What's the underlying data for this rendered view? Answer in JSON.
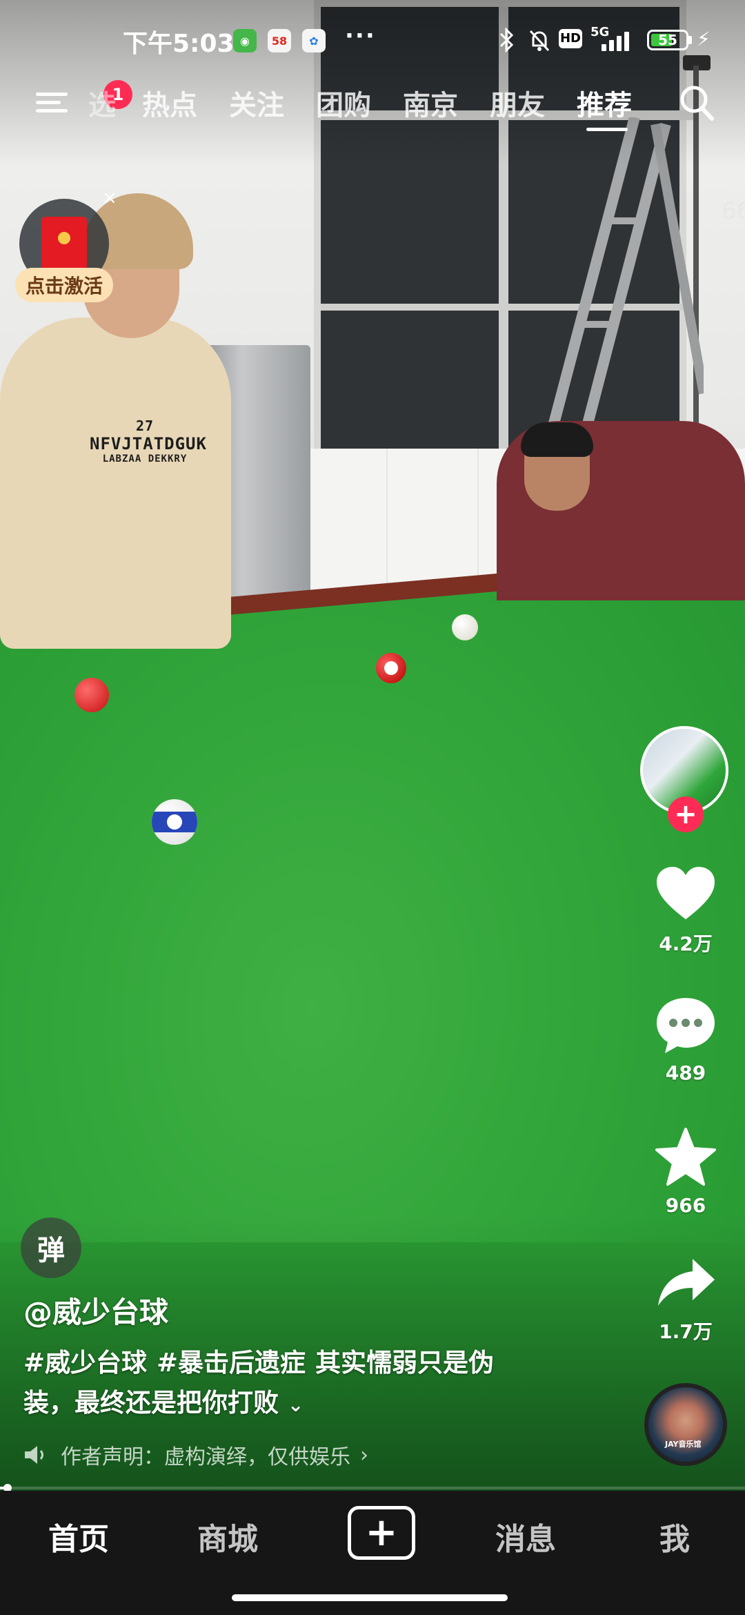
{
  "status_bar": {
    "time": "下午5:03",
    "battery_level": "55",
    "network": "5G",
    "app_icons": [
      "cat-app-icon",
      "58-app-icon",
      "cloud-app-icon"
    ],
    "app_58_label": "58",
    "more": "···",
    "system_icons": [
      "bluetooth-icon",
      "mute-bell-icon",
      "hd-icon",
      "signal-icon",
      "battery-icon",
      "charging-icon"
    ],
    "hd_label": "HD"
  },
  "top_nav": {
    "menu_badge": "1",
    "tabs": [
      {
        "label": "选",
        "active": false
      },
      {
        "label": "热点",
        "active": false
      },
      {
        "label": "关注",
        "active": false
      },
      {
        "label": "团购",
        "active": false
      },
      {
        "label": "南京",
        "active": false
      },
      {
        "label": "朋友",
        "active": false
      },
      {
        "label": "推荐",
        "active": true
      }
    ]
  },
  "promo": {
    "activate_label": "点击激活",
    "close": "×",
    "yuan": "¥"
  },
  "edge_number": "66",
  "scene": {
    "shirt_text": "NFVJTATDGUK",
    "shirt_sub": "LABZAA DEKKRY",
    "shirt_num": "27"
  },
  "right_rail": {
    "like_count": "4.2万",
    "comment_count": "489",
    "favorite_count": "966",
    "share_count": "1.7万",
    "follow_symbol": "+",
    "music_tag": "JAY音乐馆"
  },
  "video_info": {
    "danmu_label": "弹",
    "author": "@威少台球",
    "hashtags": [
      "#威少台球",
      "#暴击后遗症"
    ],
    "caption_line1_rest": "其实懦弱只是伪",
    "caption_line2": "装，最终还是把你打败",
    "expand_symbol": "⌄",
    "declaration": "作者声明：虚构演绎，仅供娱乐",
    "declaration_arrow": "›",
    "progress": 0.01
  },
  "bottom_nav": {
    "items": [
      {
        "label": "首页",
        "active": true
      },
      {
        "label": "商城",
        "active": false
      },
      {
        "label": "消息",
        "active": false
      },
      {
        "label": "我",
        "active": false
      }
    ],
    "create_symbol": "+"
  },
  "colors": {
    "accent": "#fe2c55",
    "felt": "#2ea238",
    "nav_bg": "#161616"
  }
}
